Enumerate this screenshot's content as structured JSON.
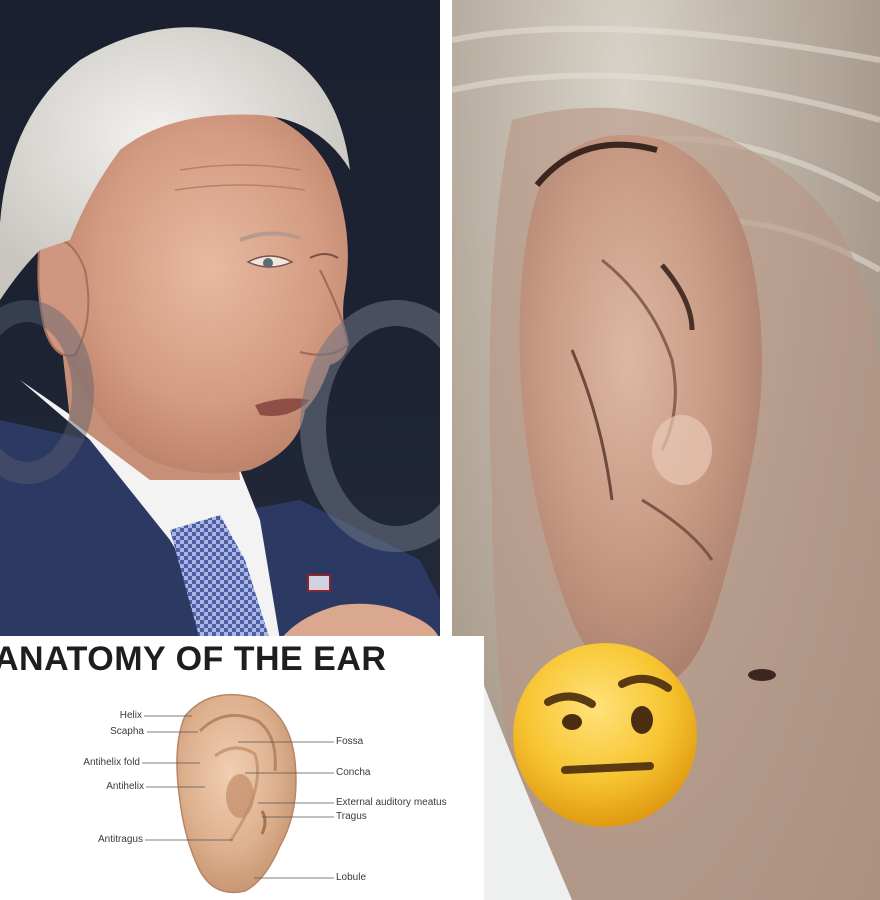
{
  "anatomy": {
    "title": "ANATOMY OF THE EAR",
    "labels": {
      "helix": "Helix",
      "scapha": "Scapha",
      "antihelix_fold": "Antihelix fold",
      "antihelix": "Antihelix",
      "antitragus": "Antitragus",
      "fossa": "Fossa",
      "concha": "Concha",
      "external_auditory_meatus": "External auditory meatus",
      "tragus": "Tragus",
      "lobule": "Lobule"
    }
  },
  "images": {
    "left_photo": "man-profile-photo",
    "right_photo": "ear-closeup-photo",
    "emoji": "face-with-raised-eyebrow-emoji"
  },
  "colors": {
    "suit": "#2c3a63",
    "background_dark": "#1d2332",
    "skin": "#d9a88f",
    "emoji_yellow": "#f7c531"
  }
}
